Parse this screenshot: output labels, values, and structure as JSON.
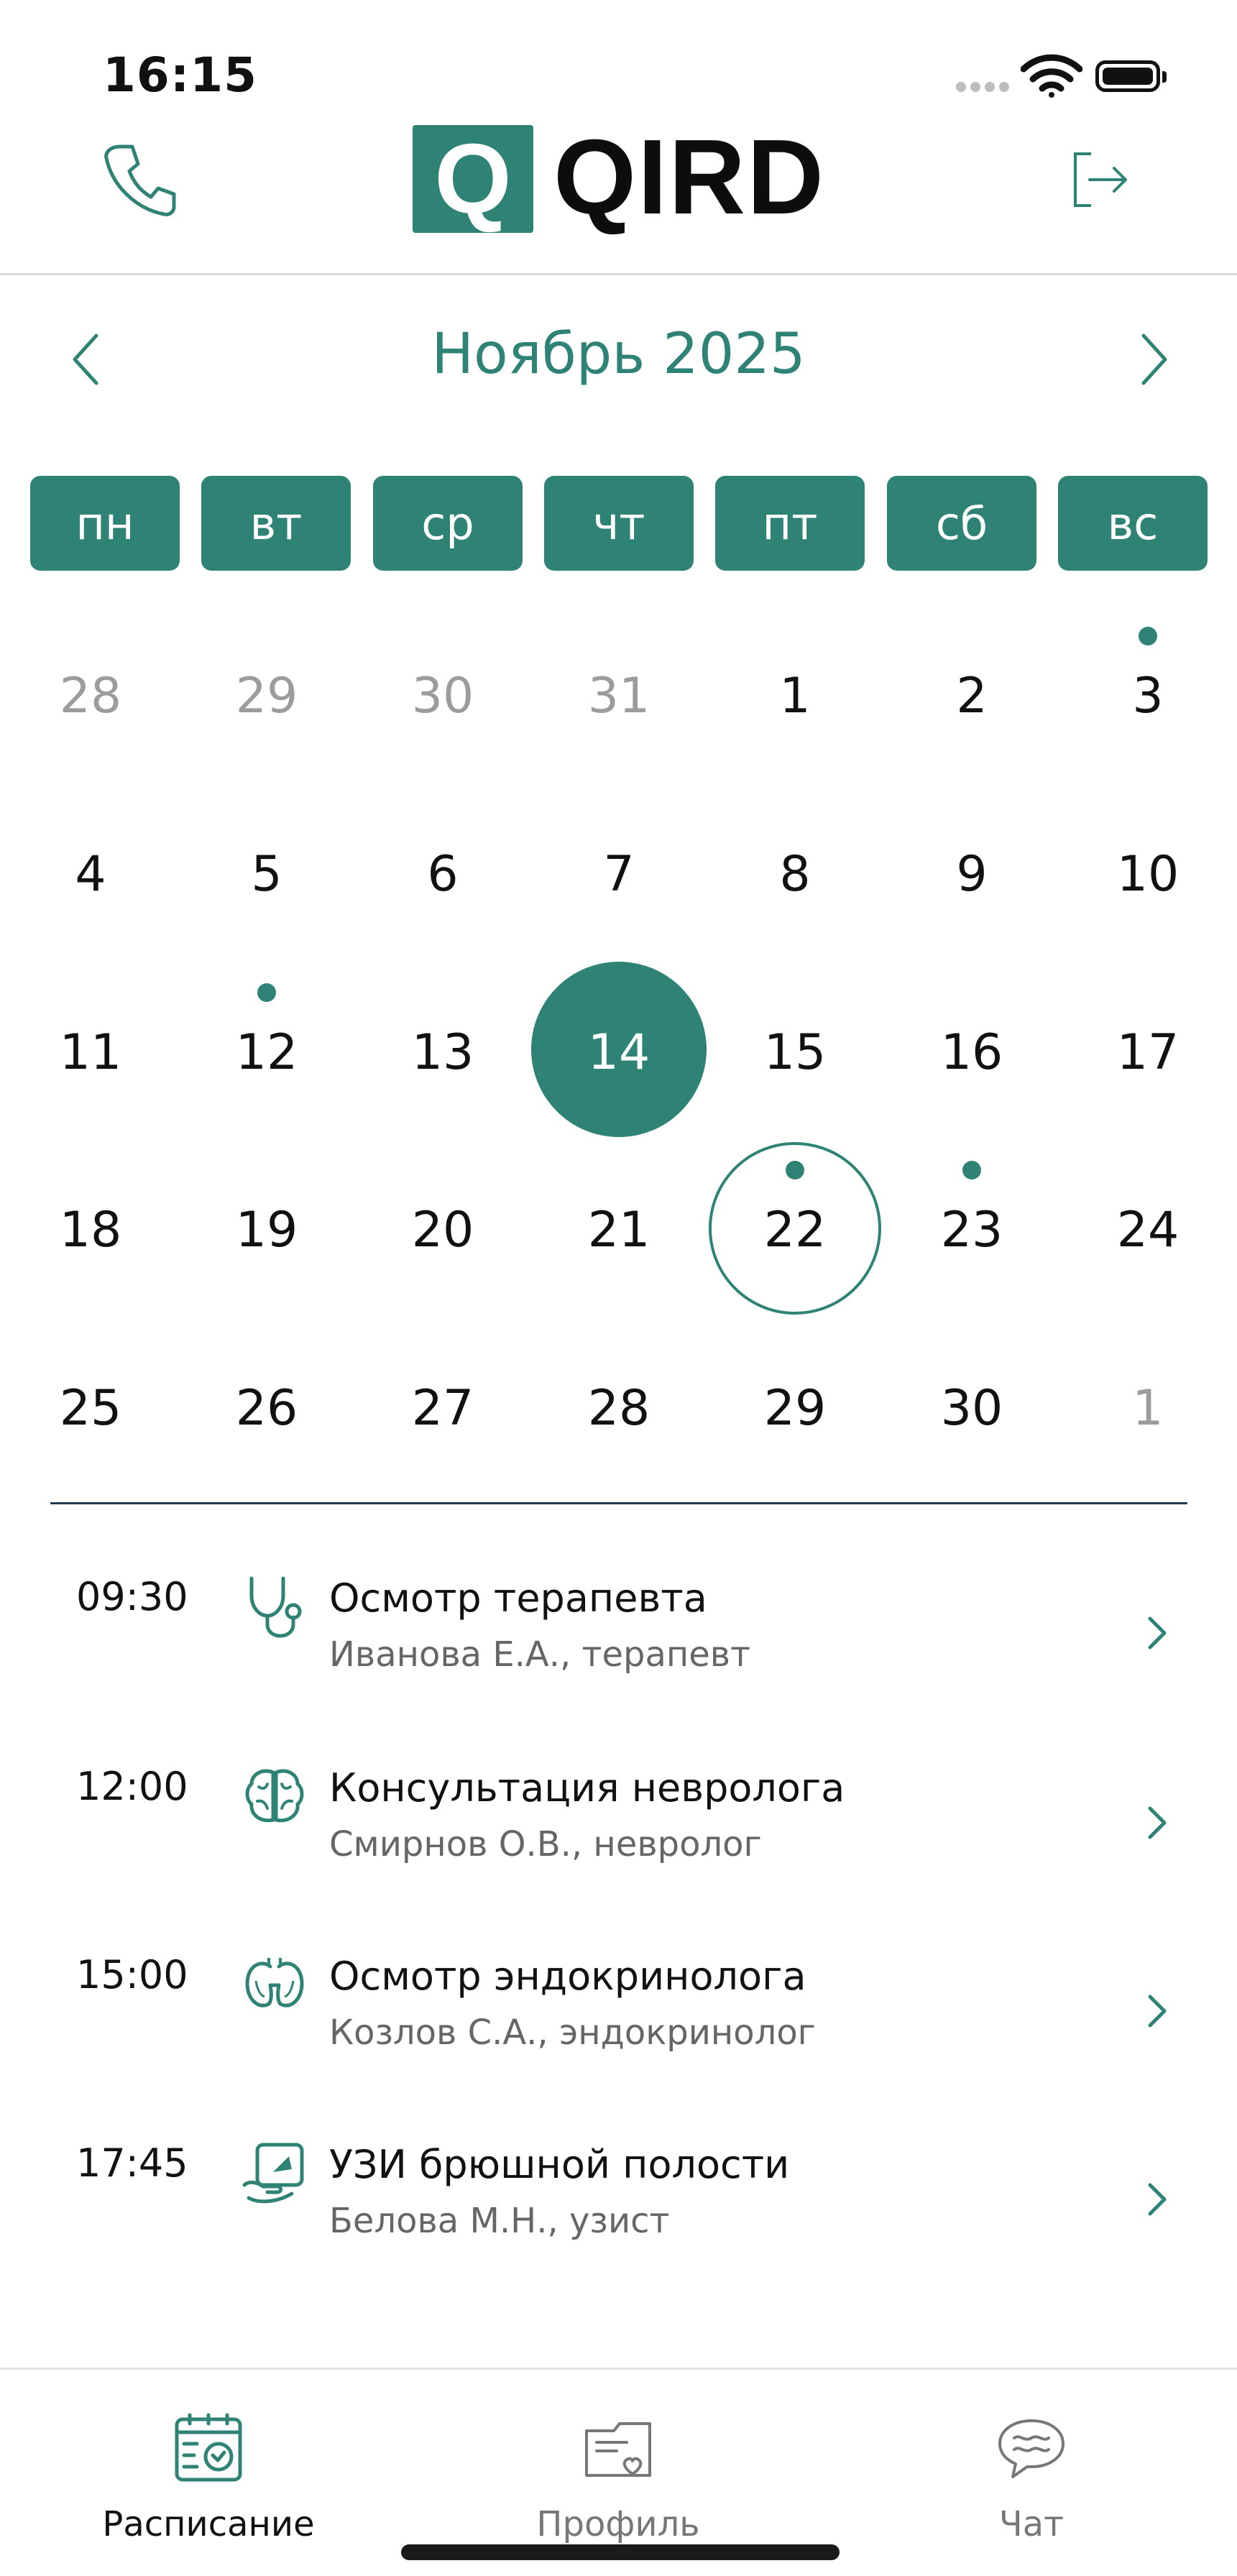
{
  "status_bar": {
    "time": "16:15"
  },
  "header": {
    "logo_mark": "Q",
    "logo_text": "QIRD"
  },
  "calendar": {
    "month_title": "Ноябрь 2025",
    "weekdays": [
      "пн",
      "вт",
      "ср",
      "чт",
      "пт",
      "сб",
      "вс"
    ],
    "weeks": [
      [
        "28",
        "29",
        "30",
        "31",
        "1",
        "2",
        "3"
      ],
      [
        "4",
        "5",
        "6",
        "7",
        "8",
        "9",
        "10"
      ],
      [
        "11",
        "12",
        "13",
        "14",
        "15",
        "16",
        "17"
      ],
      [
        "18",
        "19",
        "20",
        "21",
        "22",
        "23",
        "24"
      ],
      [
        "25",
        "26",
        "27",
        "28",
        "29",
        "30",
        "1"
      ]
    ],
    "other_month_days": [
      [
        0,
        0
      ],
      [
        0,
        1
      ],
      [
        0,
        2
      ],
      [
        0,
        3
      ],
      [
        4,
        6
      ]
    ],
    "selected_day": "14",
    "outlined_day": "22",
    "event_dot_days": [
      "3",
      "12",
      "22",
      "23"
    ]
  },
  "appointments": [
    {
      "time": "09:30",
      "icon": "stethoscope-icon",
      "title": "Осмотр терапевта",
      "doctor": "Иванова Е.А., терапевт"
    },
    {
      "time": "12:00",
      "icon": "brain-icon",
      "title": "Консультация невролога",
      "doctor": "Смирнов О.В., невролог"
    },
    {
      "time": "15:00",
      "icon": "thyroid-icon",
      "title": "Осмотр эндокринолога",
      "doctor": "Козлов С.А., эндокринолог"
    },
    {
      "time": "17:45",
      "icon": "ultrasound-icon",
      "title": "УЗИ брюшной полости",
      "doctor": "Белова М.Н., узист"
    }
  ],
  "tabs": [
    {
      "label": "Расписание",
      "icon": "calendar-clock-icon",
      "active": true
    },
    {
      "label": "Профиль",
      "icon": "medical-card-icon",
      "active": false
    },
    {
      "label": "Чат",
      "icon": "chat-bubble-icon",
      "active": false
    }
  ],
  "colors": {
    "accent": "#2e8375",
    "divider": "#1f3b4d",
    "muted": "#9c9c9c"
  }
}
